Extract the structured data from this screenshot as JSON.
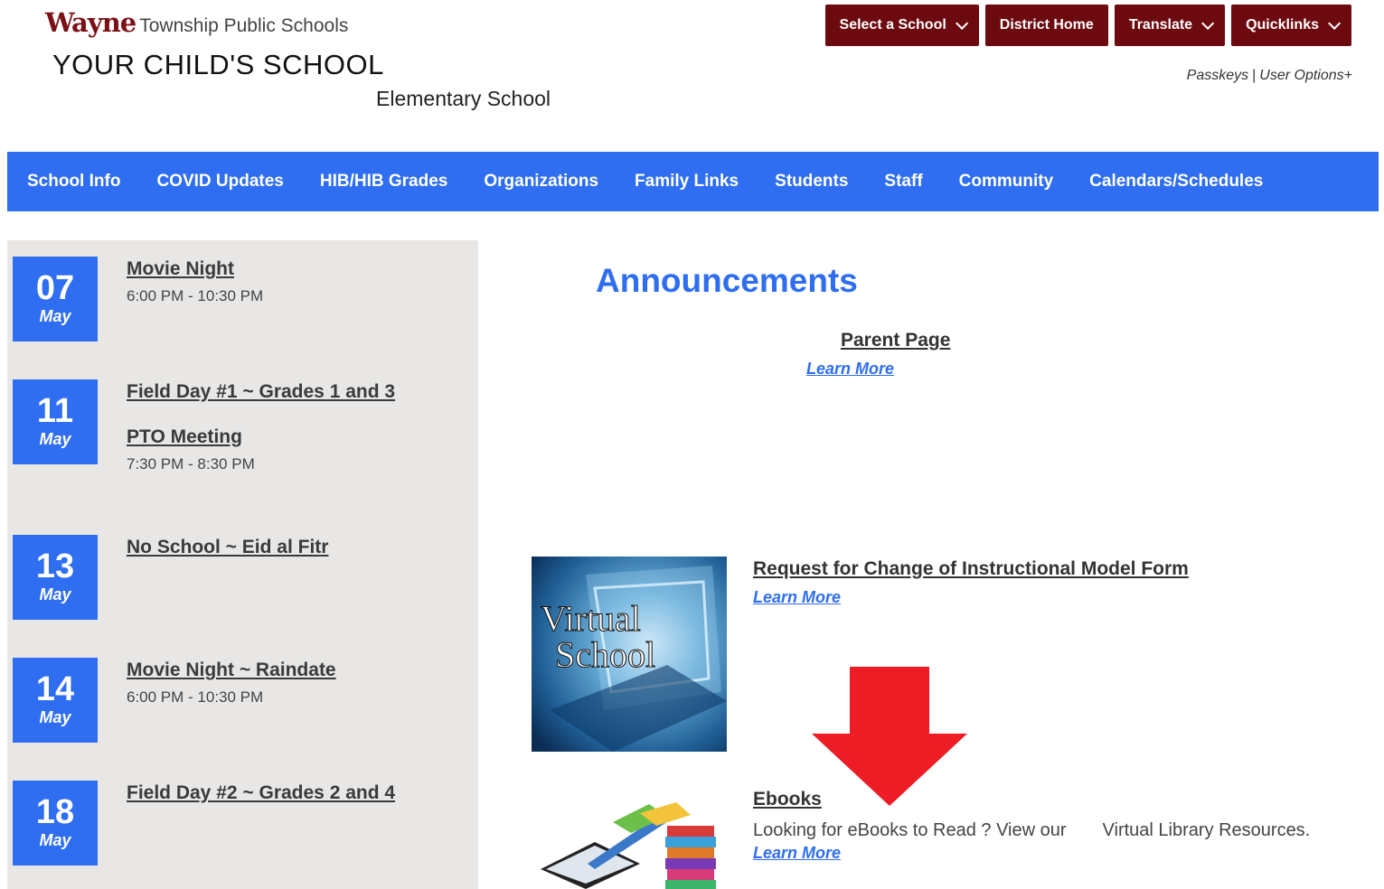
{
  "header": {
    "logo_brand": "Wayne",
    "logo_text": "Township Public Schools",
    "school_name": "YOUR CHILD'S SCHOOL",
    "school_type": "Elementary School",
    "buttons": [
      {
        "label": "Select a School",
        "dropdown": true
      },
      {
        "label": "District Home",
        "dropdown": false
      },
      {
        "label": "Translate",
        "dropdown": true
      },
      {
        "label": "Quicklinks",
        "dropdown": true
      }
    ],
    "user_links": {
      "passkeys": "Passkeys",
      "separator": "|",
      "user_options": "User Options+"
    }
  },
  "nav": {
    "items": [
      "School Info",
      "COVID Updates",
      "HIB/HIB Grades",
      "Organizations",
      "Family Links",
      "Students",
      "Staff",
      "Community",
      "Calendars/Schedules"
    ]
  },
  "events": [
    {
      "day": "07",
      "month": "May",
      "items": [
        {
          "title": "Movie Night",
          "time": "6:00 PM - 10:30 PM"
        }
      ]
    },
    {
      "day": "11",
      "month": "May",
      "items": [
        {
          "title": "Field Day #1 ~ Grades 1 and 3",
          "time": ""
        },
        {
          "title": "PTO Meeting",
          "time": "7:30 PM - 8:30 PM"
        }
      ]
    },
    {
      "day": "13",
      "month": "May",
      "items": [
        {
          "title": "No School ~ Eid al Fitr",
          "time": ""
        }
      ]
    },
    {
      "day": "14",
      "month": "May",
      "items": [
        {
          "title": "Movie Night ~ Raindate",
          "time": "6:00 PM - 10:30 PM"
        }
      ]
    },
    {
      "day": "18",
      "month": "May",
      "items": [
        {
          "title": "Field Day #2 ~ Grades 2 and 4",
          "time": ""
        }
      ]
    }
  ],
  "announcements": {
    "heading": "Announcements",
    "parent": {
      "title": "Parent Page",
      "link": "Learn More"
    },
    "request": {
      "title": "Request for Change of Instructional Model Form",
      "link": "Learn More",
      "image_text_1": "Virtual",
      "image_text_2": "School"
    },
    "ebooks": {
      "title": "Ebooks",
      "description_1": "Looking for eBooks to Read ? View our",
      "description_2": "Virtual Library Resources.",
      "link": "Learn More"
    }
  },
  "colors": {
    "maroon": "#6d0a10",
    "blue": "#2f6ef0",
    "panel": "#e8e7e6",
    "arrow": "#ee1c24"
  }
}
